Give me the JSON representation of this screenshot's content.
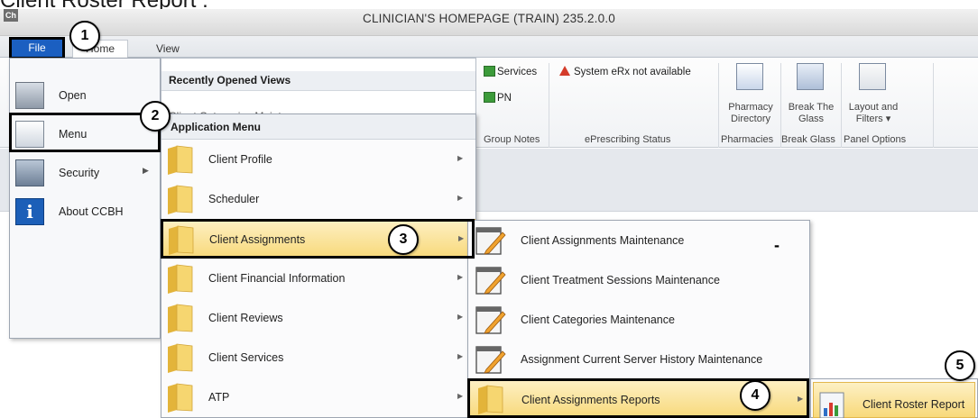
{
  "caption": "Client Roster Report :",
  "window": {
    "app_icon": "Ch",
    "title": "CLINICIAN'S HOMEPAGE (TRAIN) 235.2.0.0"
  },
  "tabs": {
    "file": "File",
    "home": "Home",
    "view": "View"
  },
  "ribbon": {
    "services": "Services",
    "pn": "PN",
    "group_notes": "Group Notes",
    "erx": "System eRx not available",
    "eprescribing_status": "ePrescribing Status",
    "pharmacy_directory": "Pharmacy Directory",
    "break_the_glass": "Break The Glass",
    "layout_filters": "Layout and Filters",
    "pharmacies": "Pharmacies",
    "break_glass": "Break Glass",
    "panel_options": "Panel Options"
  },
  "file_menu": {
    "items": [
      {
        "label": "Open",
        "icon": "open-icon"
      },
      {
        "label": "Menu",
        "icon": "menu-icon"
      },
      {
        "label": "Security",
        "icon": "security-icon"
      },
      {
        "label": "About CCBH",
        "icon": "info-icon"
      }
    ]
  },
  "recent": {
    "header": "Recently Opened Views",
    "item": "Client Categories Maintenance"
  },
  "app_menu": {
    "header": "Application Menu",
    "items": [
      {
        "label": "Client Profile"
      },
      {
        "label": "Scheduler"
      },
      {
        "label": "Client Assignments"
      },
      {
        "label": "Client Financial Information"
      },
      {
        "label": "Client Reviews"
      },
      {
        "label": "Client Services"
      },
      {
        "label": "ATP"
      }
    ]
  },
  "assignments_menu": {
    "items": [
      {
        "label": "Client Assignments Maintenance"
      },
      {
        "label": "Client Treatment Sessions Maintenance"
      },
      {
        "label": "Client Categories Maintenance"
      },
      {
        "label": "Assignment Current Server History Maintenance"
      },
      {
        "label": "Client Assignments Reports"
      }
    ]
  },
  "reports_menu": {
    "items": [
      {
        "label": "Client Roster Report"
      }
    ]
  },
  "steps": [
    "1",
    "2",
    "3",
    "4",
    "5"
  ],
  "colors": {
    "file_tab": "#1b5fc1",
    "highlight": "#f8d97a",
    "callout": "#000000"
  }
}
